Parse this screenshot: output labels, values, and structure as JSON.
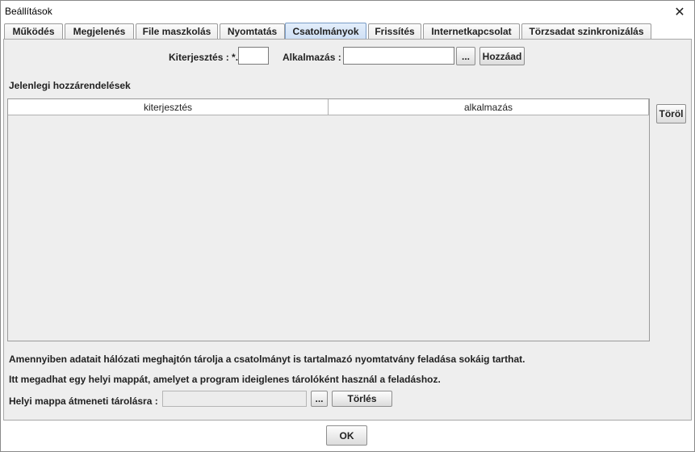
{
  "window": {
    "title": "Beállítások",
    "close_glyph": "✕"
  },
  "tabs": [
    {
      "label": "Működés",
      "active": false
    },
    {
      "label": "Megjelenés",
      "active": false
    },
    {
      "label": "File maszkolás",
      "active": false
    },
    {
      "label": "Nyomtatás",
      "active": false
    },
    {
      "label": "Csatolmányok",
      "active": true
    },
    {
      "label": "Frissítés",
      "active": false
    },
    {
      "label": "Internetkapcsolat",
      "active": false
    },
    {
      "label": "Törzsadat szinkronizálás",
      "active": false
    }
  ],
  "add_row": {
    "extension_label": "Kiterjesztés : *.",
    "extension_value": "",
    "application_label": "Alkalmazás :",
    "application_value": "",
    "browse_label": "...",
    "add_button": "Hozzáad"
  },
  "assignments": {
    "title": "Jelenlegi hozzárendelések",
    "columns": [
      "kiterjesztés",
      "alkalmazás"
    ],
    "rows": [],
    "delete_button": "Töröl"
  },
  "info": {
    "line1": "Amennyiben adatait hálózati meghajtón tárolja a csatolmányt is tartalmazó nyomtatvány feladása sokáig tarthat.",
    "line2": "Itt megadhat egy helyi mappát, amelyet a program ideiglenes tárolóként használ a feladáshoz."
  },
  "temp_folder": {
    "label": "Helyi mappa átmeneti tárolásra :",
    "value": "",
    "browse_label": "...",
    "clear_button": "Törlés"
  },
  "footer": {
    "ok_button": "OK"
  }
}
